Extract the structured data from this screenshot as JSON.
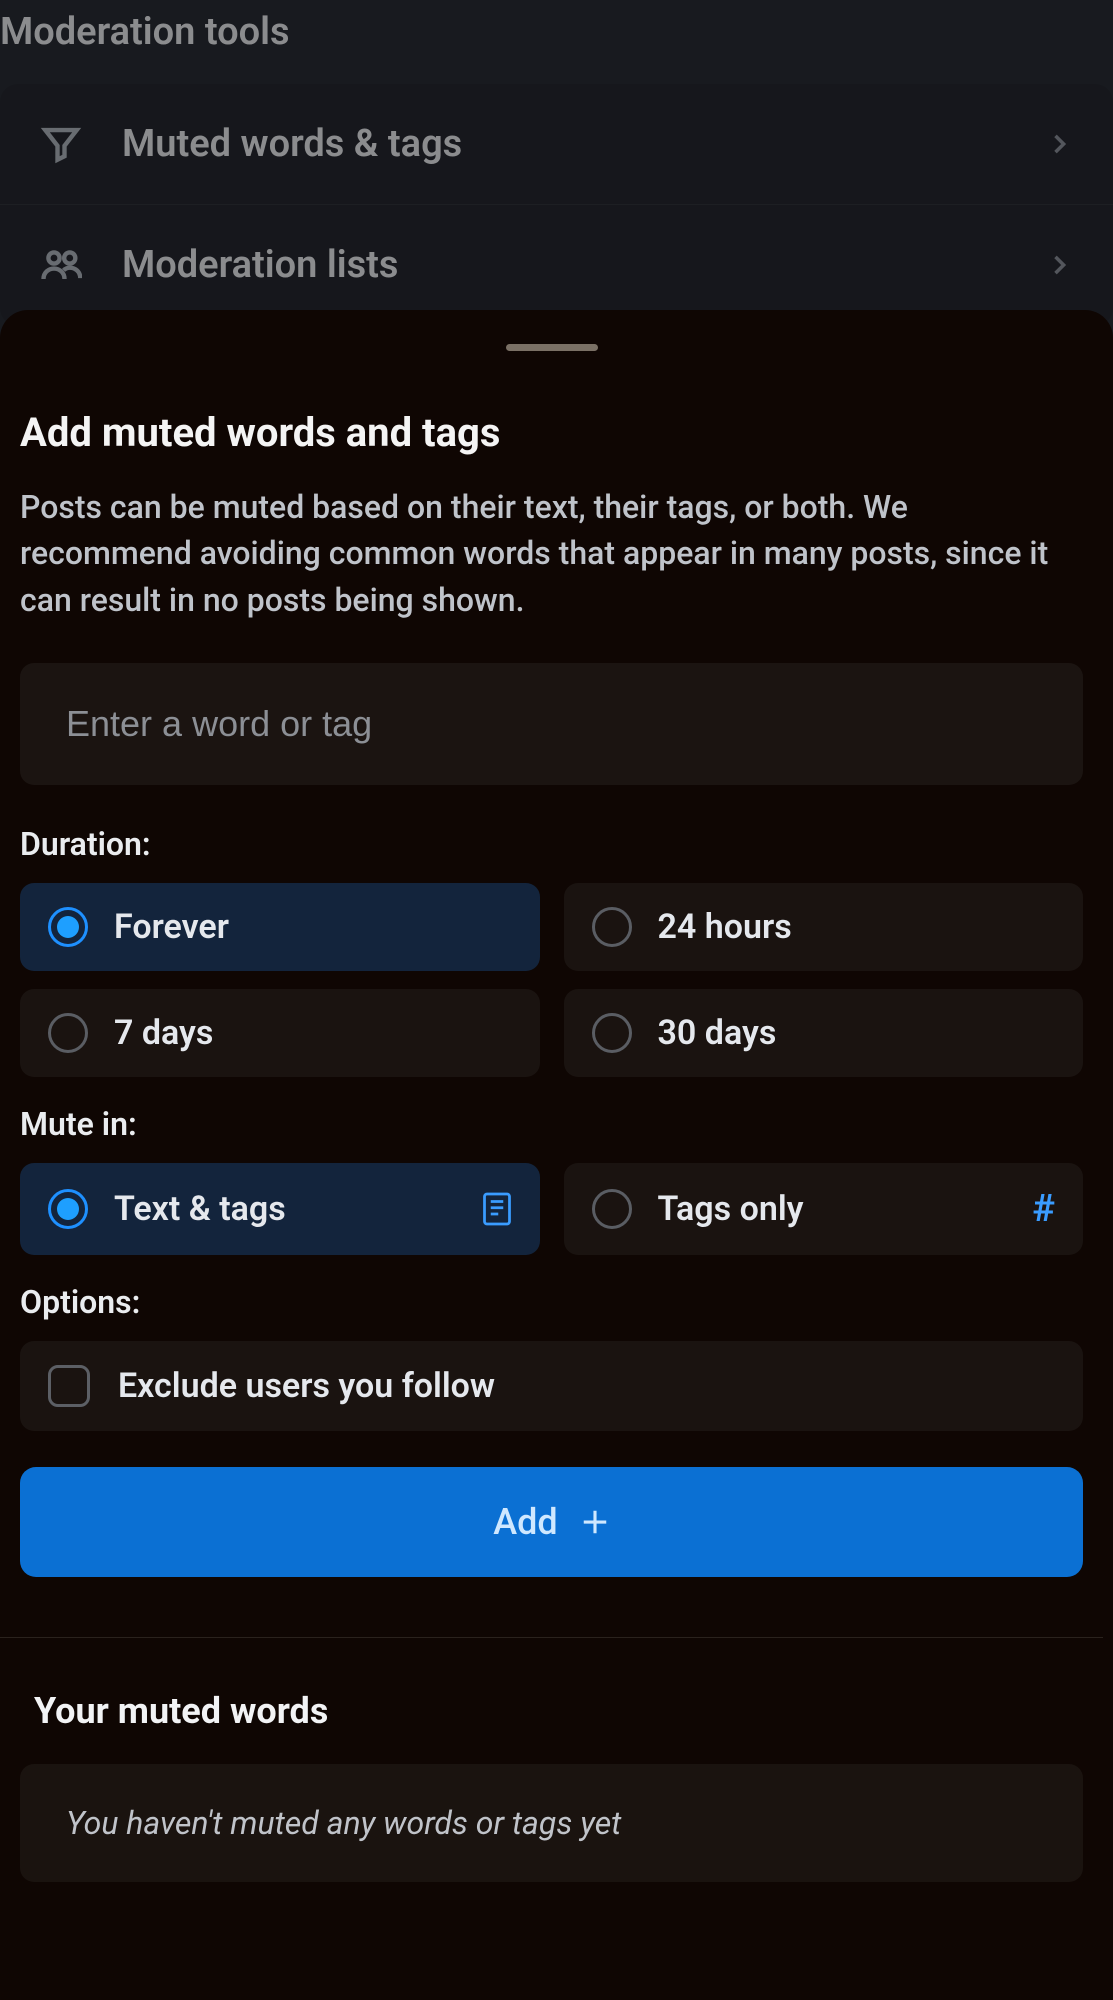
{
  "background": {
    "title": "Moderation tools",
    "rows": [
      {
        "label": "Muted words & tags"
      },
      {
        "label": "Moderation lists"
      }
    ]
  },
  "sheet": {
    "title": "Add muted words and tags",
    "description": "Posts can be muted based on their text, their tags, or both. We recommend avoiding common words that appear in many posts, since it can result in no posts being shown.",
    "input_placeholder": "Enter a word or tag",
    "duration_label": "Duration:",
    "durations": [
      {
        "label": "Forever",
        "selected": true
      },
      {
        "label": "24 hours",
        "selected": false
      },
      {
        "label": "7 days",
        "selected": false
      },
      {
        "label": "30 days",
        "selected": false
      }
    ],
    "mute_in_label": "Mute in:",
    "mute_in": [
      {
        "label": "Text & tags",
        "selected": true,
        "icon": "page"
      },
      {
        "label": "Tags only",
        "selected": false,
        "icon": "hash"
      }
    ],
    "options_label": "Options:",
    "exclude_label": "Exclude users you follow",
    "exclude_checked": false,
    "add_label": "Add",
    "muted_section_title": "Your muted words",
    "empty_text": "You haven't muted any words or tags yet"
  }
}
